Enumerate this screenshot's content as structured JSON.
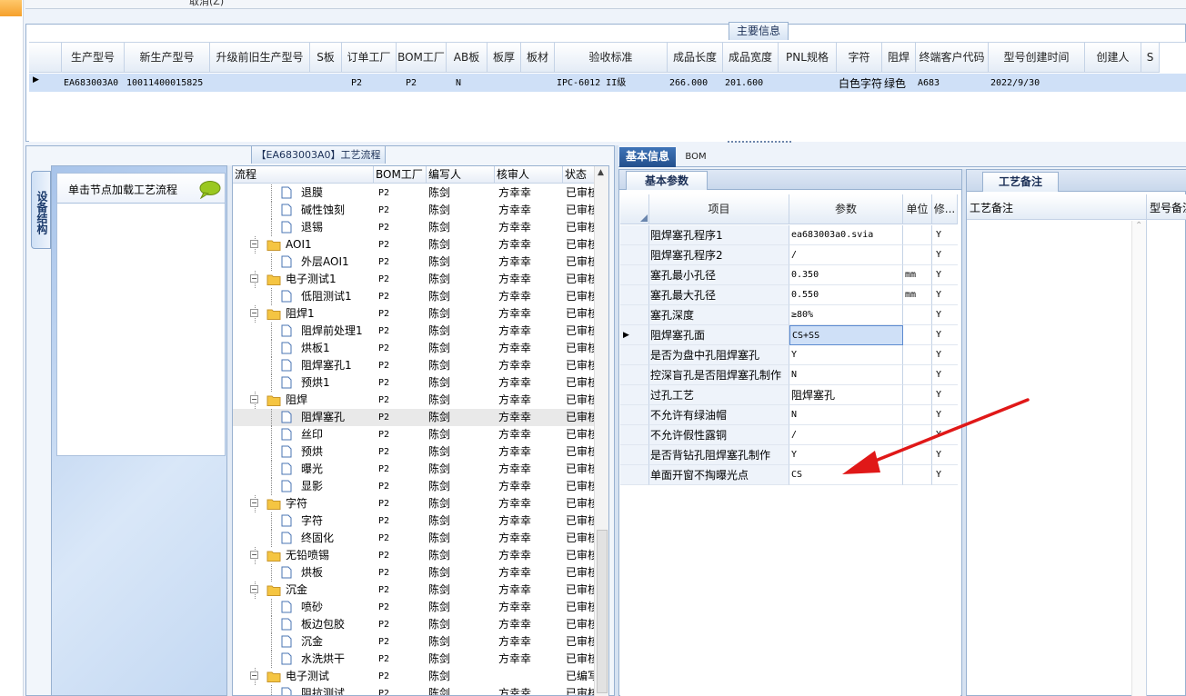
{
  "top": {
    "cancel_label": "取消(Z)"
  },
  "main_info": {
    "title": "主要信息",
    "columns": [
      "生产型号",
      "新生产型号",
      "升级前旧生产型号",
      "S板",
      "订单工厂",
      "BOM工厂",
      "AB板",
      "板厚",
      "板材",
      "验收标准",
      "成品长度",
      "成品宽度",
      "PNL规格",
      "字符",
      "阻焊",
      "终端客户代码",
      "型号创建时间",
      "创建人",
      "S"
    ],
    "row": [
      "EA683003A0",
      "10011400015825",
      "",
      "",
      "P2",
      "P2",
      "N",
      "",
      "",
      "IPC-6012 II级",
      "266.000",
      "201.600",
      "",
      "白色字符",
      "绿色",
      "A683",
      "2022/9/30",
      "",
      ""
    ]
  },
  "process": {
    "title": "【EA683003A0】工艺流程",
    "side_tab": "设备结构",
    "hint": "单击节点加载工艺流程",
    "columns": [
      "流程",
      "BOM工厂",
      "编写人",
      "核审人",
      "状态"
    ],
    "rows": [
      {
        "name": "退膜",
        "level": 2,
        "type": "doc",
        "bom": "P2",
        "writer": "陈剑",
        "reviewer": "方幸幸",
        "status": "已审核"
      },
      {
        "name": "碱性蚀刻",
        "level": 2,
        "type": "doc",
        "bom": "P2",
        "writer": "陈剑",
        "reviewer": "方幸幸",
        "status": "已审核"
      },
      {
        "name": "退锡",
        "level": 2,
        "type": "doc",
        "bom": "P2",
        "writer": "陈剑",
        "reviewer": "方幸幸",
        "status": "已审核"
      },
      {
        "name": "AOI1",
        "level": 1,
        "type": "folder",
        "bom": "P2",
        "writer": "陈剑",
        "reviewer": "方幸幸",
        "status": "已审核"
      },
      {
        "name": "外层AOI1",
        "level": 2,
        "type": "doc",
        "bom": "P2",
        "writer": "陈剑",
        "reviewer": "方幸幸",
        "status": "已审核"
      },
      {
        "name": "电子测试1",
        "level": 1,
        "type": "folder",
        "bom": "P2",
        "writer": "陈剑",
        "reviewer": "方幸幸",
        "status": "已审核"
      },
      {
        "name": "低阻测试1",
        "level": 2,
        "type": "doc",
        "bom": "P2",
        "writer": "陈剑",
        "reviewer": "方幸幸",
        "status": "已审核"
      },
      {
        "name": "阻焊1",
        "level": 1,
        "type": "folder",
        "bom": "P2",
        "writer": "陈剑",
        "reviewer": "方幸幸",
        "status": "已审核"
      },
      {
        "name": "阻焊前处理1",
        "level": 2,
        "type": "doc",
        "bom": "P2",
        "writer": "陈剑",
        "reviewer": "方幸幸",
        "status": "已审核"
      },
      {
        "name": "烘板1",
        "level": 2,
        "type": "doc",
        "bom": "P2",
        "writer": "陈剑",
        "reviewer": "方幸幸",
        "status": "已审核"
      },
      {
        "name": "阻焊塞孔1",
        "level": 2,
        "type": "doc",
        "bom": "P2",
        "writer": "陈剑",
        "reviewer": "方幸幸",
        "status": "已审核"
      },
      {
        "name": "预烘1",
        "level": 2,
        "type": "doc",
        "bom": "P2",
        "writer": "陈剑",
        "reviewer": "方幸幸",
        "status": "已审核"
      },
      {
        "name": "阻焊",
        "level": 1,
        "type": "folder",
        "bom": "P2",
        "writer": "陈剑",
        "reviewer": "方幸幸",
        "status": "已审核"
      },
      {
        "name": "阻焊塞孔",
        "level": 2,
        "type": "doc",
        "bom": "P2",
        "writer": "陈剑",
        "reviewer": "方幸幸",
        "status": "已审核",
        "selected": true
      },
      {
        "name": "丝印",
        "level": 2,
        "type": "doc",
        "bom": "P2",
        "writer": "陈剑",
        "reviewer": "方幸幸",
        "status": "已审核"
      },
      {
        "name": "预烘",
        "level": 2,
        "type": "doc",
        "bom": "P2",
        "writer": "陈剑",
        "reviewer": "方幸幸",
        "status": "已审核"
      },
      {
        "name": "曝光",
        "level": 2,
        "type": "doc",
        "bom": "P2",
        "writer": "陈剑",
        "reviewer": "方幸幸",
        "status": "已审核"
      },
      {
        "name": "显影",
        "level": 2,
        "type": "doc",
        "bom": "P2",
        "writer": "陈剑",
        "reviewer": "方幸幸",
        "status": "已审核"
      },
      {
        "name": "字符",
        "level": 1,
        "type": "folder",
        "bom": "P2",
        "writer": "陈剑",
        "reviewer": "方幸幸",
        "status": "已审核"
      },
      {
        "name": "字符",
        "level": 2,
        "type": "doc",
        "bom": "P2",
        "writer": "陈剑",
        "reviewer": "方幸幸",
        "status": "已审核"
      },
      {
        "name": "终固化",
        "level": 2,
        "type": "doc",
        "bom": "P2",
        "writer": "陈剑",
        "reviewer": "方幸幸",
        "status": "已审核"
      },
      {
        "name": "无铅喷锡",
        "level": 1,
        "type": "folder",
        "bom": "P2",
        "writer": "陈剑",
        "reviewer": "方幸幸",
        "status": "已审核"
      },
      {
        "name": "烘板",
        "level": 2,
        "type": "doc",
        "bom": "P2",
        "writer": "陈剑",
        "reviewer": "方幸幸",
        "status": "已审核"
      },
      {
        "name": "沉金",
        "level": 1,
        "type": "folder",
        "bom": "P2",
        "writer": "陈剑",
        "reviewer": "方幸幸",
        "status": "已审核"
      },
      {
        "name": "喷砂",
        "level": 2,
        "type": "doc",
        "bom": "P2",
        "writer": "陈剑",
        "reviewer": "方幸幸",
        "status": "已审核"
      },
      {
        "name": "板边包胶",
        "level": 2,
        "type": "doc",
        "bom": "P2",
        "writer": "陈剑",
        "reviewer": "方幸幸",
        "status": "已审核"
      },
      {
        "name": "沉金",
        "level": 2,
        "type": "doc",
        "bom": "P2",
        "writer": "陈剑",
        "reviewer": "方幸幸",
        "status": "已审核"
      },
      {
        "name": "水洗烘干",
        "level": 2,
        "type": "doc",
        "bom": "P2",
        "writer": "陈剑",
        "reviewer": "方幸幸",
        "status": "已审核"
      },
      {
        "name": "电子测试",
        "level": 1,
        "type": "folder",
        "bom": "P2",
        "writer": "陈剑",
        "reviewer": "",
        "status": "已编写"
      },
      {
        "name": "阻抗测试",
        "level": 2,
        "type": "doc",
        "bom": "P2",
        "writer": "陈剑",
        "reviewer": "方幸幸",
        "status": "已审核"
      }
    ]
  },
  "basic": {
    "tabs": [
      "基本信息",
      "BOM"
    ],
    "section": "基本参数",
    "columns": [
      "项目",
      "参数",
      "单位",
      "修..."
    ],
    "rows": [
      {
        "item": "阻焊塞孔程序1",
        "param": "ea683003a0.svia",
        "unit": "",
        "mod": "Y"
      },
      {
        "item": "阻焊塞孔程序2",
        "param": "/",
        "unit": "",
        "mod": "Y"
      },
      {
        "item": "塞孔最小孔径",
        "param": "0.350",
        "unit": "mm",
        "mod": "Y"
      },
      {
        "item": "塞孔最大孔径",
        "param": "0.550",
        "unit": "mm",
        "mod": "Y"
      },
      {
        "item": "塞孔深度",
        "param": "≥80%",
        "unit": "",
        "mod": "Y"
      },
      {
        "item": "阻焊塞孔面",
        "param": "CS+SS",
        "unit": "",
        "mod": "Y",
        "current": true
      },
      {
        "item": "是否为盘中孔阻焊塞孔",
        "param": "Y",
        "unit": "",
        "mod": "Y"
      },
      {
        "item": "控深盲孔是否阻焊塞孔制作",
        "param": "N",
        "unit": "",
        "mod": "Y"
      },
      {
        "item": "过孔工艺",
        "param": "阻焊塞孔",
        "unit": "",
        "mod": "Y"
      },
      {
        "item": "不允许有绿油帽",
        "param": "N",
        "unit": "",
        "mod": "Y"
      },
      {
        "item": "不允许假性露铜",
        "param": "/",
        "unit": "",
        "mod": "Y"
      },
      {
        "item": "是否背钻孔阻焊塞孔制作",
        "param": "Y",
        "unit": "",
        "mod": "Y"
      },
      {
        "item": "单面开窗不掏曝光点",
        "param": "CS",
        "unit": "",
        "mod": "Y"
      }
    ]
  },
  "remark": {
    "title": "工艺备注",
    "col1": "工艺备注",
    "col2": "型号备注"
  },
  "colors": {
    "selection": "#cfe0f7",
    "header_blue": "#2b5d9e",
    "annotation_arrow": "#e01818"
  }
}
